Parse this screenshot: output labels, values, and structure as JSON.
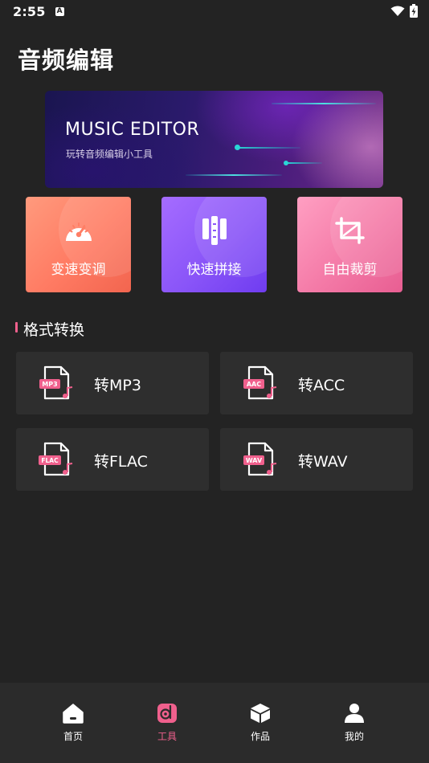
{
  "status_bar": {
    "time": "2:55",
    "notification_icon": "A"
  },
  "page_title": "音频编辑",
  "banner": {
    "title": "MUSIC EDITOR",
    "subtitle": "玩转音频编辑小工具"
  },
  "tools": [
    {
      "label": "变速变调",
      "icon": "speedometer-icon"
    },
    {
      "label": "快速拼接",
      "icon": "splice-icon"
    },
    {
      "label": "自由裁剪",
      "icon": "crop-icon"
    }
  ],
  "format_section": {
    "title": "格式转换",
    "items": [
      {
        "label": "转MP3",
        "badge": "MP3"
      },
      {
        "label": "转ACC",
        "badge": "AAC"
      },
      {
        "label": "转FLAC",
        "badge": "FLAC"
      },
      {
        "label": "转WAV",
        "badge": "WAV"
      }
    ]
  },
  "tab_bar": {
    "tabs": [
      {
        "label": "首页",
        "icon": "home-icon"
      },
      {
        "label": "工具",
        "icon": "tools-icon",
        "active": true
      },
      {
        "label": "作品",
        "icon": "box-icon"
      },
      {
        "label": "我的",
        "icon": "user-icon"
      }
    ]
  },
  "colors": {
    "background": "#232323",
    "accent": "#f0608d",
    "card": "#2e2e2e",
    "tab_bar": "#2b2b2b"
  }
}
